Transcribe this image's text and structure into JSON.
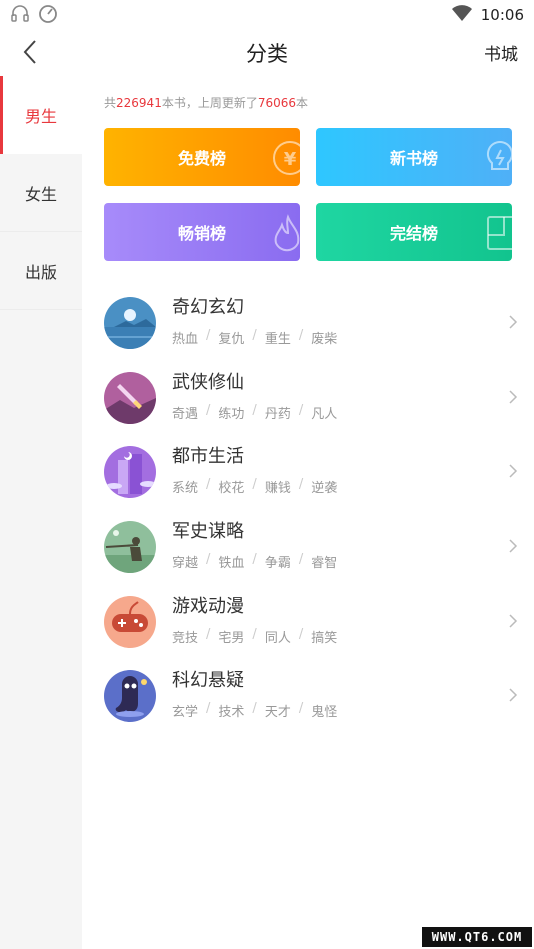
{
  "status_bar": {
    "time": "10:06"
  },
  "header": {
    "title": "分类",
    "right_link": "书城"
  },
  "sidebar": {
    "tabs": [
      {
        "label": "男生",
        "active": true
      },
      {
        "label": "女生",
        "active": false
      },
      {
        "label": "出版",
        "active": false
      }
    ]
  },
  "summary": {
    "prefix": "共",
    "book_count": "226941",
    "middle": "本书，上周更新了",
    "updated_count": "76066",
    "suffix": "本"
  },
  "rank_cards": [
    {
      "label": "免费榜",
      "color": "#ffa000"
    },
    {
      "label": "新书榜",
      "color": "#3bbdfb"
    },
    {
      "label": "畅销榜",
      "color": "#9a7df6"
    },
    {
      "label": "完结榜",
      "color": "#18cf98"
    }
  ],
  "categories": [
    {
      "title": "奇幻玄幻",
      "tags": [
        "热血",
        "复仇",
        "重生",
        "废柴"
      ]
    },
    {
      "title": "武侠修仙",
      "tags": [
        "奇遇",
        "练功",
        "丹药",
        "凡人"
      ]
    },
    {
      "title": "都市生活",
      "tags": [
        "系统",
        "校花",
        "赚钱",
        "逆袭"
      ]
    },
    {
      "title": "军史谋略",
      "tags": [
        "穿越",
        "铁血",
        "争霸",
        "睿智"
      ]
    },
    {
      "title": "游戏动漫",
      "tags": [
        "竞技",
        "宅男",
        "同人",
        "搞笑"
      ]
    },
    {
      "title": "科幻悬疑",
      "tags": [
        "玄学",
        "技术",
        "天才",
        "鬼怪"
      ]
    }
  ],
  "watermark": "WWW.QT6.COM",
  "accent_color": "#e8383d"
}
